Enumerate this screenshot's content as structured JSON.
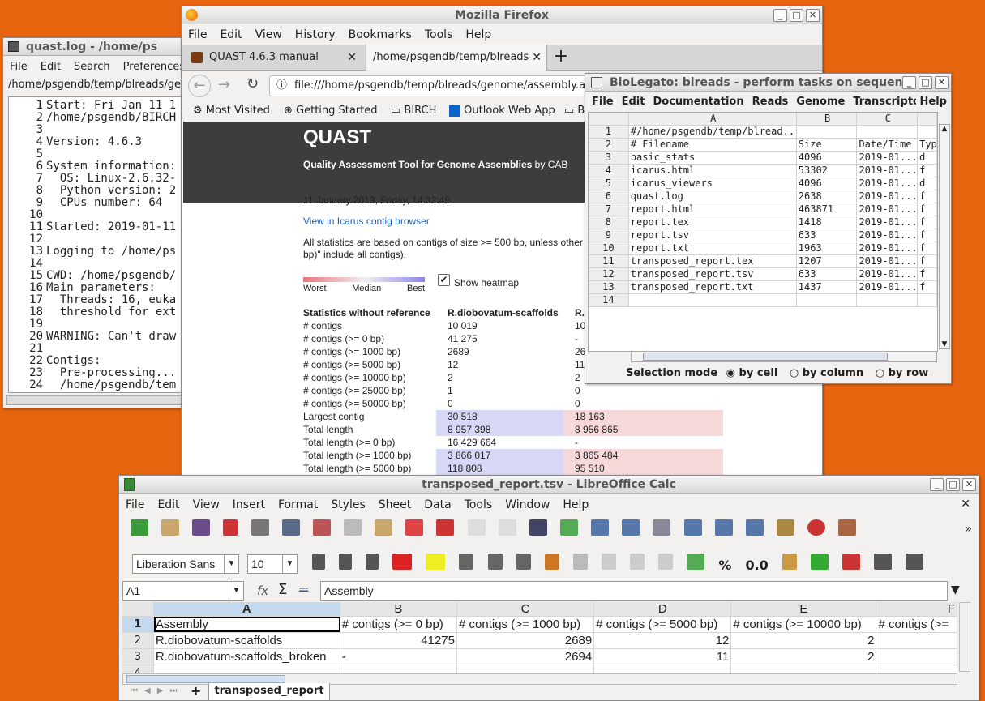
{
  "log": {
    "title": "quast.log - /home/ps",
    "menus": [
      "File",
      "Edit",
      "Search",
      "Preferences"
    ],
    "path": "/home/psgendb/temp/blreads/geno",
    "lines": [
      {
        "n": "1",
        "t": "Start: Fri Jan 11 1"
      },
      {
        "n": "2",
        "t": "/home/psgendb/BIRCH"
      },
      {
        "n": "3",
        "t": ""
      },
      {
        "n": "4",
        "t": "Version: 4.6.3"
      },
      {
        "n": "5",
        "t": ""
      },
      {
        "n": "6",
        "t": "System information:"
      },
      {
        "n": "7",
        "t": "  OS: Linux-2.6.32-"
      },
      {
        "n": "8",
        "t": "  Python version: 2"
      },
      {
        "n": "9",
        "t": "  CPUs number: 64"
      },
      {
        "n": "10",
        "t": ""
      },
      {
        "n": "11",
        "t": "Started: 2019-01-11"
      },
      {
        "n": "12",
        "t": ""
      },
      {
        "n": "13",
        "t": "Logging to /home/ps"
      },
      {
        "n": "14",
        "t": ""
      },
      {
        "n": "15",
        "t": "CWD: /home/psgendb/"
      },
      {
        "n": "16",
        "t": "Main parameters:"
      },
      {
        "n": "17",
        "t": "  Threads: 16, euka"
      },
      {
        "n": "18",
        "t": "  threshold for ext"
      },
      {
        "n": "19",
        "t": ""
      },
      {
        "n": "20",
        "t": "WARNING: Can't draw"
      },
      {
        "n": "21",
        "t": ""
      },
      {
        "n": "22",
        "t": "Contigs:"
      },
      {
        "n": "23",
        "t": "  Pre-processing..."
      },
      {
        "n": "24",
        "t": "  /home/psgendb/tem"
      }
    ]
  },
  "firefox": {
    "title": "Mozilla Firefox",
    "menus": [
      "File",
      "Edit",
      "View",
      "History",
      "Bookmarks",
      "Tools",
      "Help"
    ],
    "tabs": [
      "QUAST 4.6.3 manual",
      "/home/psgendb/temp/blreads"
    ],
    "url": "file:///home/psgendb/temp/blreads/genome/assembly.a",
    "bookmarks": [
      "Most Visited",
      "Getting Started",
      "BIRCH",
      "Outlook Web App",
      "B"
    ],
    "page": {
      "title": "QUAST",
      "subtitle": "Quality Assessment Tool for Genome Assemblies",
      "by": "by",
      "cab": "CAB",
      "date": "11 January 2019, Friday, 14:32:49",
      "icarus": "View in Icarus contig browser",
      "note1": "All statistics are based on contigs of size >= 500 bp, unless other",
      "note2": "bp)\" include all contigs).",
      "legend": [
        "Worst",
        "Median",
        "Best"
      ],
      "heatmap": "Show heatmap",
      "headers": [
        "Statistics without reference",
        "R.diobovatum-scaffolds",
        "R."
      ],
      "rows": [
        {
          "k": "# contigs",
          "a": "10 019",
          "b": "10",
          "hl": ""
        },
        {
          "k": "# contigs (>= 0 bp)",
          "a": "41 275",
          "b": "-",
          "hl": ""
        },
        {
          "k": "# contigs (>= 1000 bp)",
          "a": "2689",
          "b": "26",
          "hl": ""
        },
        {
          "k": "# contigs (>= 5000 bp)",
          "a": "12",
          "b": "11",
          "hl": ""
        },
        {
          "k": "# contigs (>= 10000 bp)",
          "a": "2",
          "b": "2",
          "hl": ""
        },
        {
          "k": "# contigs (>= 25000 bp)",
          "a": "1",
          "b": "0",
          "hl": ""
        },
        {
          "k": "# contigs (>= 50000 bp)",
          "a": "0",
          "b": "0",
          "hl": ""
        },
        {
          "k": "Largest contig",
          "a": "30 518",
          "b": "18 163",
          "hl": "y"
        },
        {
          "k": "Total length",
          "a": "8 957 398",
          "b": "8 956 865",
          "hl": "y"
        },
        {
          "k": "Total length (>= 0 bp)",
          "a": "16 429 664",
          "b": "-",
          "hl": ""
        },
        {
          "k": "Total length (>= 1000 bp)",
          "a": "3 866 017",
          "b": "3 865 484",
          "hl": "y"
        },
        {
          "k": "Total length (>= 5000 bp)",
          "a": "118 808",
          "b": "95 510",
          "hl": "y"
        }
      ]
    }
  },
  "biolegato": {
    "title": "BioLegato: blreads - perform tasks on sequen",
    "menus": [
      "File",
      "Edit",
      "Documentation",
      "Reads",
      "Genome",
      "Transcriptome",
      "Help"
    ],
    "cols": [
      "A",
      "B",
      "C"
    ],
    "rows": [
      {
        "n": "1",
        "a": "#/home/psgendb/temp/blread...",
        "b": "",
        "c": "",
        "d": ""
      },
      {
        "n": "2",
        "a": "# Filename",
        "b": "Size",
        "c": "Date/Time",
        "d": "Typ"
      },
      {
        "n": "3",
        "a": "basic_stats",
        "b": "4096",
        "c": "2019-01...",
        "d": "d"
      },
      {
        "n": "4",
        "a": "icarus.html",
        "b": "53302",
        "c": "2019-01...",
        "d": "f"
      },
      {
        "n": "5",
        "a": "icarus_viewers",
        "b": "4096",
        "c": "2019-01...",
        "d": "d"
      },
      {
        "n": "6",
        "a": "quast.log",
        "b": "2638",
        "c": "2019-01...",
        "d": "f"
      },
      {
        "n": "7",
        "a": "report.html",
        "b": "463871",
        "c": "2019-01...",
        "d": "f"
      },
      {
        "n": "8",
        "a": "report.tex",
        "b": "1418",
        "c": "2019-01...",
        "d": "f"
      },
      {
        "n": "9",
        "a": "report.tsv",
        "b": "633",
        "c": "2019-01...",
        "d": "f"
      },
      {
        "n": "10",
        "a": "report.txt",
        "b": "1963",
        "c": "2019-01...",
        "d": "f"
      },
      {
        "n": "11",
        "a": "transposed_report.tex",
        "b": "1207",
        "c": "2019-01...",
        "d": "f"
      },
      {
        "n": "12",
        "a": "transposed_report.tsv",
        "b": "633",
        "c": "2019-01...",
        "d": "f"
      },
      {
        "n": "13",
        "a": "transposed_report.txt",
        "b": "1437",
        "c": "2019-01...",
        "d": "f"
      },
      {
        "n": "14",
        "a": "",
        "b": "",
        "c": "",
        "d": ""
      }
    ],
    "selection_label": "Selection mode",
    "modes": [
      "by cell",
      "by column",
      "by row"
    ]
  },
  "calc": {
    "title": "transposed_report.tsv - LibreOffice Calc",
    "menus": [
      "File",
      "Edit",
      "View",
      "Insert",
      "Format",
      "Styles",
      "Sheet",
      "Data",
      "Tools",
      "Window",
      "Help"
    ],
    "font": "Liberation Sans",
    "size": "10",
    "cellref": "A1",
    "formula": "Assembly",
    "cols": [
      "A",
      "B",
      "C",
      "D",
      "E",
      "F"
    ],
    "rows": [
      {
        "n": "1",
        "c": [
          "Assembly",
          "# contigs (>= 0 bp)",
          "# contigs (>= 1000 bp)",
          "# contigs (>= 5000 bp)",
          "# contigs (>= 10000 bp)",
          "# contigs (>="
        ]
      },
      {
        "n": "2",
        "c": [
          "R.diobovatum-scaffolds",
          "41275",
          "2689",
          "12",
          "2",
          ""
        ]
      },
      {
        "n": "3",
        "c": [
          "R.diobovatum-scaffolds_broken",
          "-",
          "2694",
          "11",
          "2",
          ""
        ]
      },
      {
        "n": "4",
        "c": [
          "",
          "",
          "",
          "",
          "",
          ""
        ]
      }
    ],
    "sheet_tab": "transposed_report",
    "zero": "0.0"
  }
}
